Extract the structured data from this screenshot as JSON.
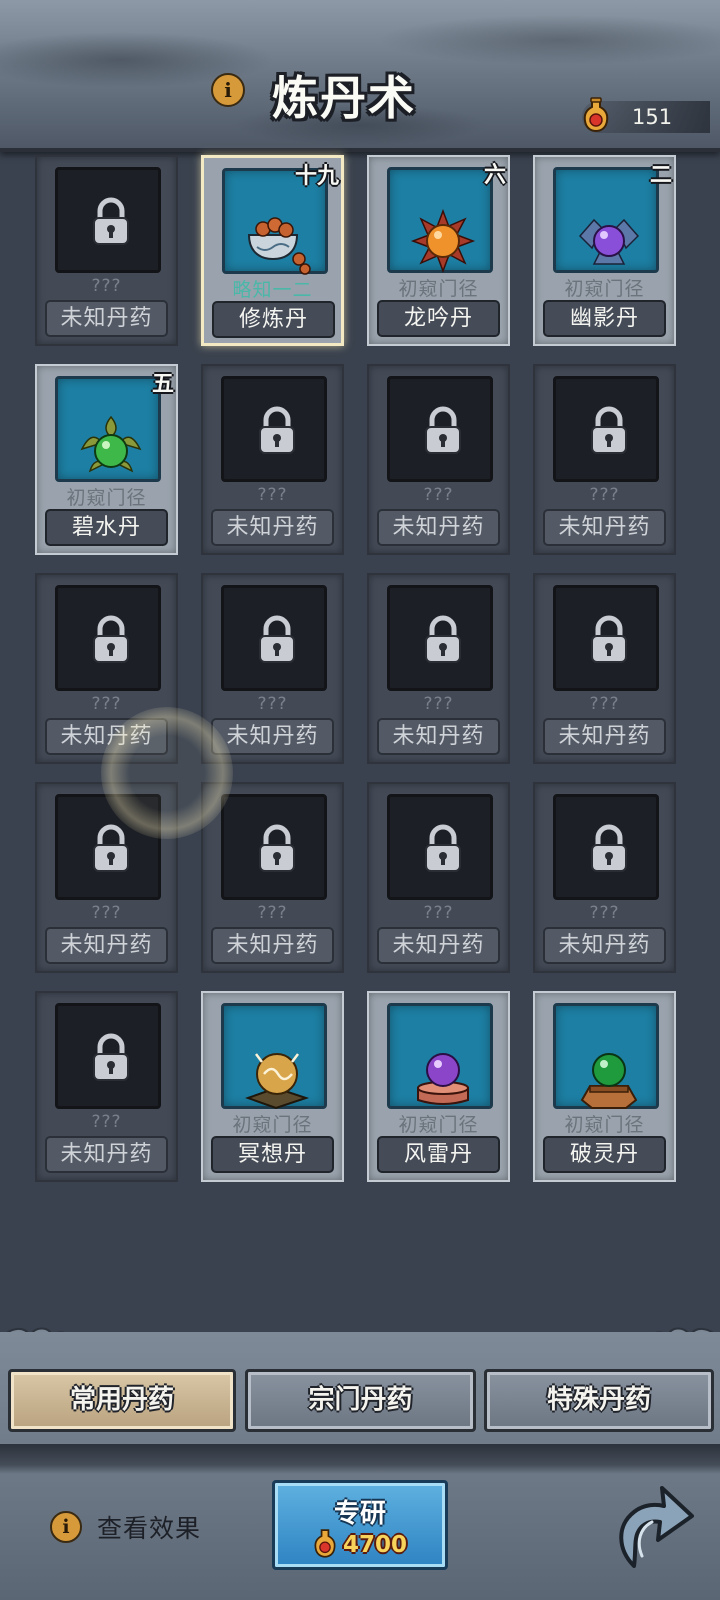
{
  "header": {
    "title": "炼丹术",
    "info_icon": "i",
    "currency_icon": "elixir-flask-icon",
    "currency_value": "151"
  },
  "pills": [
    {
      "rank": "",
      "level": "???",
      "name": "未知丹药",
      "state": "locked",
      "icon": "lock-icon"
    },
    {
      "rank": "十九",
      "level": "略知一二",
      "name": "修炼丹",
      "state": "known",
      "selected": true,
      "icon": "cultivation-pill-bowl-icon"
    },
    {
      "rank": "六",
      "level": "初窥门径",
      "name": "龙吟丹",
      "state": "known",
      "icon": "dragon-roar-pill-icon"
    },
    {
      "rank": "二",
      "level": "初窥门径",
      "name": "幽影丹",
      "state": "known",
      "icon": "shadow-pill-icon"
    },
    {
      "rank": "五",
      "level": "初窥门径",
      "name": "碧水丹",
      "state": "known",
      "icon": "jade-water-pill-icon"
    },
    {
      "rank": "",
      "level": "???",
      "name": "未知丹药",
      "state": "locked",
      "icon": "lock-icon"
    },
    {
      "rank": "",
      "level": "???",
      "name": "未知丹药",
      "state": "locked",
      "icon": "lock-icon"
    },
    {
      "rank": "",
      "level": "???",
      "name": "未知丹药",
      "state": "locked",
      "icon": "lock-icon"
    },
    {
      "rank": "",
      "level": "???",
      "name": "未知丹药",
      "state": "locked",
      "icon": "lock-icon"
    },
    {
      "rank": "",
      "level": "???",
      "name": "未知丹药",
      "state": "locked",
      "icon": "lock-icon"
    },
    {
      "rank": "",
      "level": "???",
      "name": "未知丹药",
      "state": "locked",
      "icon": "lock-icon"
    },
    {
      "rank": "",
      "level": "???",
      "name": "未知丹药",
      "state": "locked",
      "icon": "lock-icon"
    },
    {
      "rank": "",
      "level": "???",
      "name": "未知丹药",
      "state": "locked",
      "icon": "lock-icon"
    },
    {
      "rank": "",
      "level": "???",
      "name": "未知丹药",
      "state": "locked",
      "icon": "lock-icon"
    },
    {
      "rank": "",
      "level": "???",
      "name": "未知丹药",
      "state": "locked",
      "icon": "lock-icon"
    },
    {
      "rank": "",
      "level": "???",
      "name": "未知丹药",
      "state": "locked",
      "icon": "lock-icon"
    },
    {
      "rank": "",
      "level": "???",
      "name": "未知丹药",
      "state": "locked",
      "icon": "lock-icon"
    },
    {
      "rank": "",
      "level": "初窥门径",
      "name": "冥想丹",
      "state": "known",
      "icon": "meditation-pill-icon"
    },
    {
      "rank": "",
      "level": "初窥门径",
      "name": "风雷丹",
      "state": "known",
      "icon": "wind-thunder-pill-icon"
    },
    {
      "rank": "",
      "level": "初窥门径",
      "name": "破灵丹",
      "state": "known",
      "icon": "spirit-break-pill-icon"
    }
  ],
  "tabs": [
    {
      "label": "常用丹药",
      "active": true
    },
    {
      "label": "宗门丹药",
      "active": false
    },
    {
      "label": "特殊丹药",
      "active": false
    }
  ],
  "footer": {
    "effects_label": "查看效果",
    "research_label": "专研",
    "research_cost": "4700",
    "back_icon": "back-arrow-icon"
  },
  "colors": {
    "accent_blue": "#2e83c2",
    "active_tab": "#d9c7a6",
    "teal_level": "#4ab7a9",
    "cost_gold": "#f7d35b"
  }
}
